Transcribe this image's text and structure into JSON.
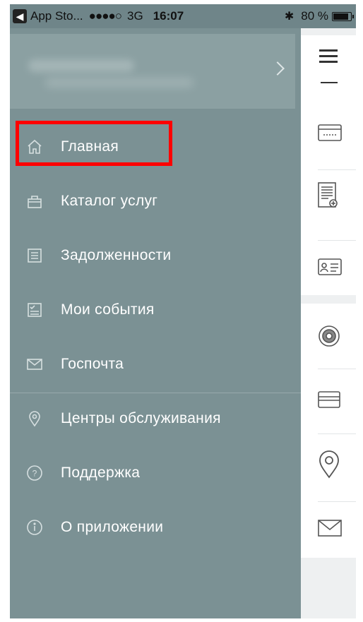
{
  "status_bar": {
    "back_app": "App Sto...",
    "signal": "●●●●○",
    "network": "3G",
    "time": "16:07",
    "bluetooth": "✱",
    "battery": "80 %"
  },
  "menu": {
    "items": [
      {
        "label": "Главная",
        "icon": "home-icon"
      },
      {
        "label": "Каталог услуг",
        "icon": "basket-icon"
      },
      {
        "label": "Задолженности",
        "icon": "list-icon"
      },
      {
        "label": "Мои события",
        "icon": "checklist-icon"
      },
      {
        "label": "Госпочта",
        "icon": "envelope-icon"
      },
      {
        "label": "Центры обслуживания",
        "icon": "location-pin-icon"
      },
      {
        "label": "Поддержка",
        "icon": "question-icon"
      },
      {
        "label": "О приложении",
        "icon": "info-icon"
      }
    ],
    "selected": "Главная"
  },
  "colors": {
    "menu_bg": "#7b9194",
    "highlight": "#ff0000"
  }
}
